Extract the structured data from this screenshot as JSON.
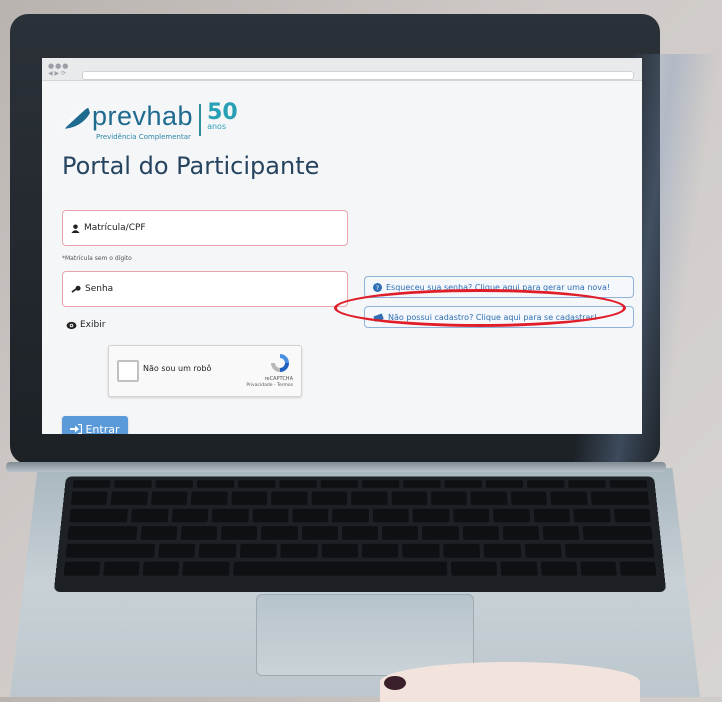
{
  "logo": {
    "brand": "prevhab",
    "subtitle": "Previdência Complementar",
    "anniversary_number": "50",
    "anniversary_label": "anos"
  },
  "page": {
    "title": "Portal do Participante"
  },
  "form": {
    "login_placeholder": "Matrícula/CPF",
    "login_hint": "*Matrícula sem o dígito",
    "password_placeholder": "Senha",
    "show_password_label": "Exibir",
    "submit_label": "Entrar"
  },
  "recaptcha": {
    "label": "Não sou um robô",
    "brand": "reCAPTCHA",
    "terms": "Privacidade - Termos"
  },
  "help_links": {
    "forgot_password": "Esqueceu sua senha? Clique aqui para gerar uma nova!",
    "register": "Não possui cadastro? Clique aqui para se cadastrar!"
  },
  "colors": {
    "brand": "#1f6b8f",
    "accent": "#27a0b5",
    "primary_button": "#5a9ad9",
    "link": "#2f6fb3",
    "highlight": "#e01e2a"
  },
  "icons": {
    "login": "user-icon",
    "password": "key-icon",
    "show_password": "eye-icon",
    "submit": "sign-in-icon",
    "forgot": "question-circle-icon",
    "register": "id-card-icon"
  }
}
